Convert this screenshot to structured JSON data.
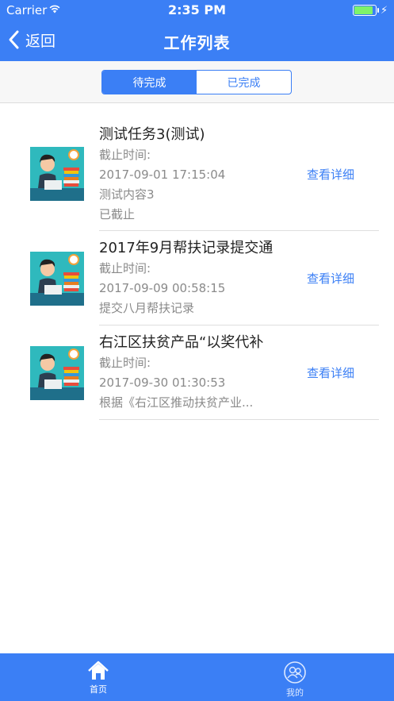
{
  "status_bar": {
    "carrier": "Carrier",
    "time": "2:35 PM"
  },
  "nav": {
    "back_label": "返回",
    "title": "工作列表"
  },
  "segments": {
    "pending": "待完成",
    "done": "已完成"
  },
  "tasks": [
    {
      "name": "测试任务3(测试)",
      "deadline_label": "截止时间:",
      "deadline": "2017-09-01 17:15:04",
      "content": "测试内容3",
      "status": "已截止",
      "detail_label": "查看详细"
    },
    {
      "name": "2017年9月帮扶记录提交通",
      "deadline_label": "截止时间:",
      "deadline": "2017-09-09 00:58:15",
      "content": "提交八月帮扶记录",
      "detail_label": "查看详细"
    },
    {
      "name": "右江区扶贫产品“以奖代补",
      "deadline_label": "截止时间:",
      "deadline": "2017-09-30 01:30:53",
      "content": "根据《右江区推动扶贫产业...",
      "detail_label": "查看详细"
    }
  ],
  "tabbar": {
    "home": "首页",
    "mine": "我的"
  },
  "colors": {
    "primary": "#3b7ff5",
    "text": "#222222",
    "secondary_text": "#8a8a8a"
  }
}
